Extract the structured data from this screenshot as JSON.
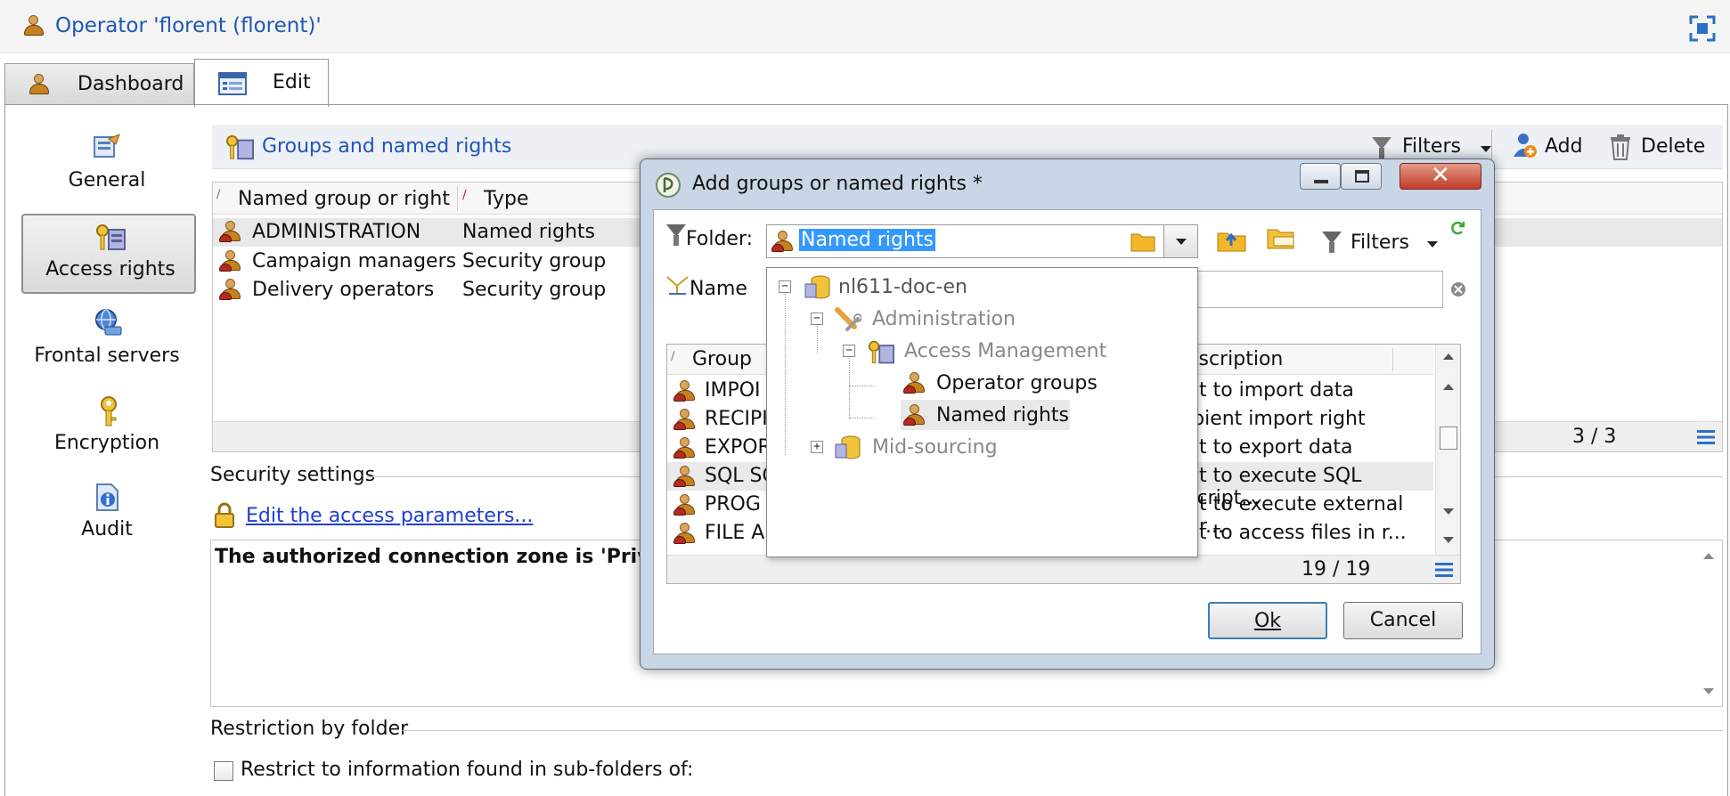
{
  "window": {
    "title": "Operator 'florent (florent)'"
  },
  "tabs": [
    {
      "label": "Dashboard"
    },
    {
      "label": "Edit"
    }
  ],
  "sidebar": {
    "items": [
      {
        "label": "General"
      },
      {
        "label": "Access rights"
      },
      {
        "label": "Frontal servers"
      },
      {
        "label": "Encryption"
      },
      {
        "label": "Audit"
      }
    ]
  },
  "groups_panel": {
    "title": "Groups and named rights",
    "filters_label": "Filters",
    "add_label": "Add",
    "delete_label": "Delete",
    "columns": [
      "Named group or right",
      "Type"
    ],
    "rows": [
      {
        "name": "ADMINISTRATION",
        "type": "Named rights"
      },
      {
        "name": "Campaign managers",
        "type": "Security group"
      },
      {
        "name": "Delivery operators",
        "type": "Security group"
      }
    ],
    "count": "3 / 3"
  },
  "security": {
    "section_label": "Security settings",
    "edit_link": "Edit the access parameters...",
    "zone_text": "The authorized connection zone is 'Private"
  },
  "restriction": {
    "section_label": "Restriction by folder",
    "checkbox_label": "Restrict to information found in sub-folders of:"
  },
  "dialog": {
    "title": "Add groups or named rights *",
    "folder_label": "Folder:",
    "folder_value": "Named rights",
    "filters_label": "Filters",
    "name_label": "Name",
    "columns": [
      "Group",
      "escription"
    ],
    "rows": [
      {
        "group": "IMPOI",
        "description": "nt to import data"
      },
      {
        "group": "RECIPI",
        "description": "ipient import right"
      },
      {
        "group": "EXPOR",
        "description": "nt to export data"
      },
      {
        "group": "SQL SC",
        "description": "nt to execute SQL script..."
      },
      {
        "group": "PROG",
        "description": "nt to execute external pr..."
      },
      {
        "group": "FILE A",
        "description": "nt to access files in r..."
      }
    ],
    "count": "19 / 19",
    "ok_label": "Ok",
    "cancel_label": "Cancel"
  },
  "folder_tree": {
    "nodes": [
      {
        "label": "nl611-doc-en"
      },
      {
        "label": "Administration"
      },
      {
        "label": "Access Management"
      },
      {
        "label": "Operator groups"
      },
      {
        "label": "Named rights"
      },
      {
        "label": "Mid-sourcing"
      }
    ]
  }
}
